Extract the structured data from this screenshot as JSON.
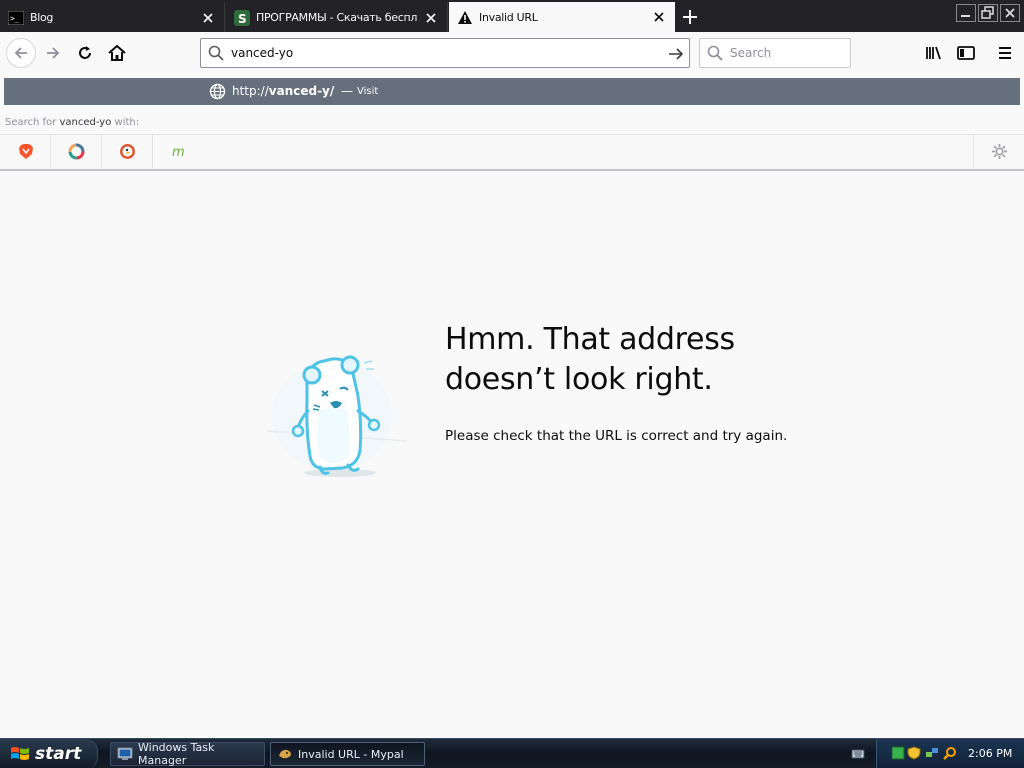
{
  "browser": {
    "tabs": [
      {
        "label": "Blog",
        "active": false
      },
      {
        "label": "ПРОГРАММЫ - Скачать бесплатн",
        "active": false
      },
      {
        "label": "Invalid URL",
        "active": true
      }
    ]
  },
  "urlbar": {
    "value": "vanced-yo"
  },
  "searchbar": {
    "placeholder": "Search"
  },
  "popup": {
    "suggestion": {
      "url_prefix": "http://",
      "url_bold": "vanced-y/",
      "separator": "—",
      "action": "Visit"
    },
    "search_for": {
      "prefix": "Search for",
      "term": "vanced-yo",
      "suffix": "with:"
    },
    "engines": [
      "brave-icon",
      "qwant-icon",
      "duckduckgo-icon",
      "mail-search-icon"
    ]
  },
  "error_page": {
    "title_line1": "Hmm. That address",
    "title_line2": "doesn’t look right.",
    "description": "Please check that the URL is correct and try again."
  },
  "taskbar": {
    "start_label": "start",
    "tasks": [
      {
        "label": "Windows Task Manager",
        "active": false
      },
      {
        "label": "Invalid URL - Mypal",
        "active": true
      }
    ],
    "clock": "2:06 PM"
  },
  "colors": {
    "accent_suggestion": "#65707c",
    "tab_strip": "#232327",
    "page_background": "#f9f9fa"
  }
}
